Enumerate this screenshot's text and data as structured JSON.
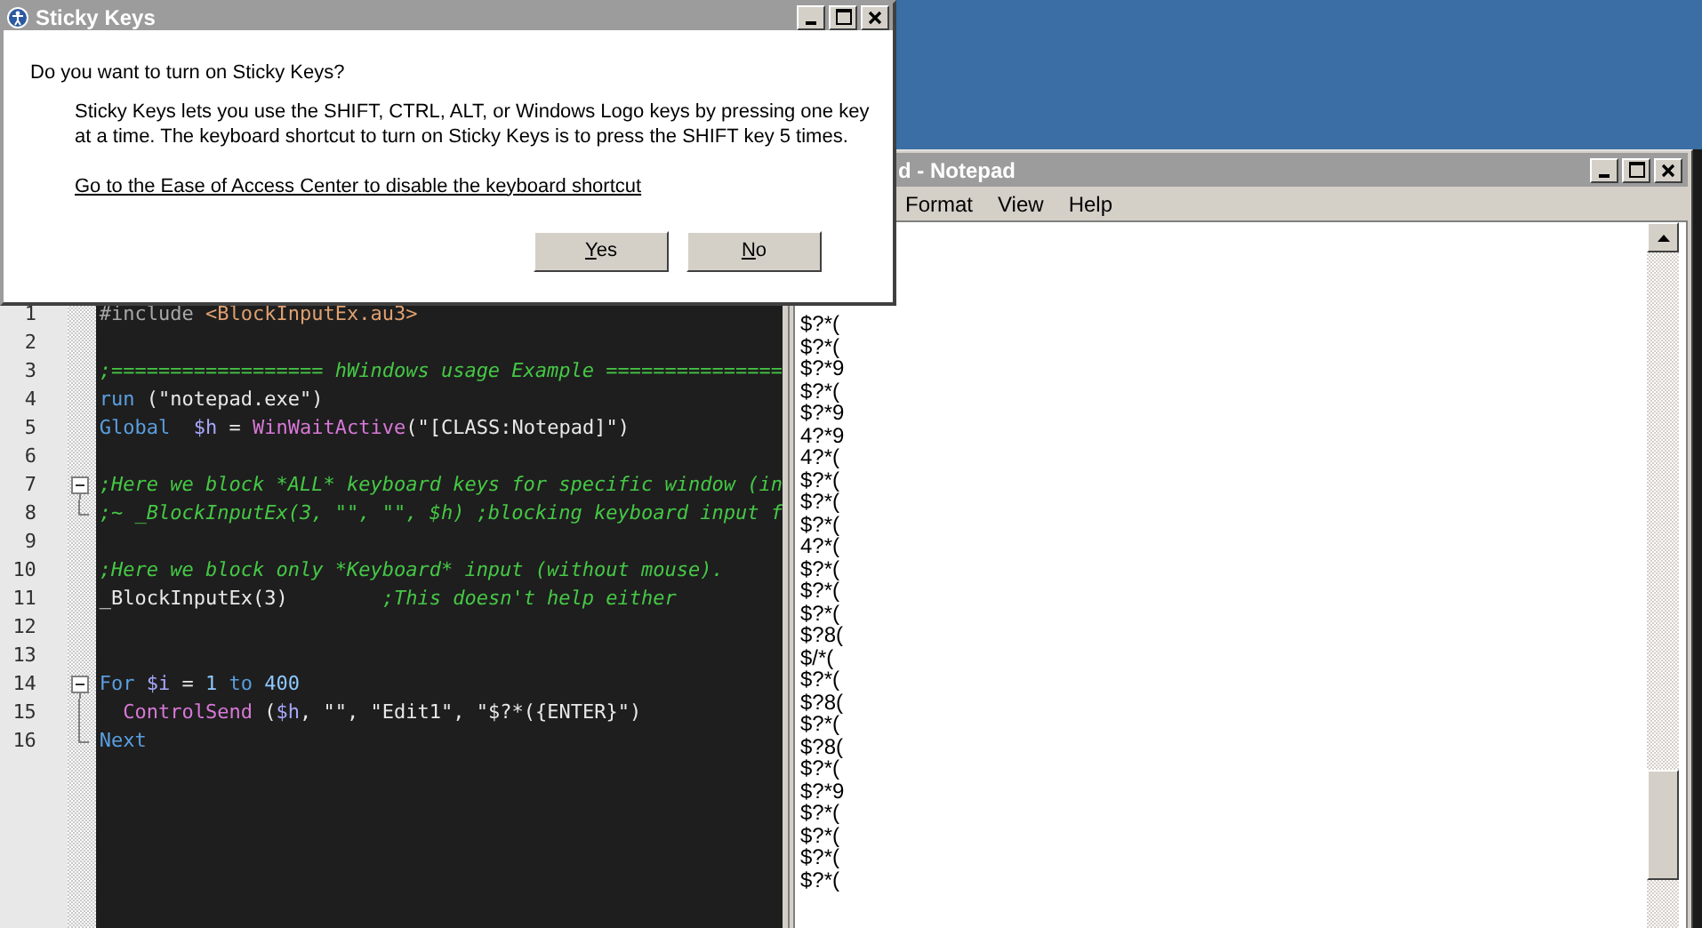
{
  "dialog": {
    "title": "Sticky Keys",
    "question": "Do you want to turn on Sticky Keys?",
    "description": "Sticky Keys lets you use the SHIFT, CTRL, ALT, or Windows Logo keys by pressing one key at a time. The keyboard shortcut to turn on Sticky Keys is to press the SHIFT key 5 times.",
    "link": "Go to the Ease of Access Center to disable the keyboard shortcut",
    "buttons": [
      {
        "label": "Yes",
        "underline_first": true
      },
      {
        "label": "No",
        "underline_first": true
      }
    ]
  },
  "editor": {
    "lines": [
      {
        "number": "1",
        "collapsible": false,
        "in_fold": false,
        "tokens": [
          {
            "kind": "directive",
            "text": "#include "
          },
          {
            "kind": "include",
            "text": "<BlockInputEx.au3>"
          }
        ]
      },
      {
        "number": "2",
        "collapsible": false,
        "in_fold": false
      },
      {
        "number": "3",
        "collapsible": false,
        "in_fold": false,
        "tokens": [
          {
            "kind": "comment",
            "text": ";================== hWindows usage Example ==============="
          }
        ]
      },
      {
        "number": "4",
        "collapsible": false,
        "in_fold": false,
        "tokens": [
          {
            "kind": "keyword",
            "text": "run"
          },
          {
            "kind": "plain",
            "text": " ("
          },
          {
            "kind": "string",
            "text": "\"notepad.exe\""
          },
          {
            "kind": "plain",
            "text": ")"
          }
        ]
      },
      {
        "number": "5",
        "collapsible": false,
        "in_fold": false,
        "tokens": [
          {
            "kind": "keyword",
            "text": "Global"
          },
          {
            "kind": "variable",
            "text": "  $h"
          },
          {
            "kind": "plain",
            "text": " = "
          },
          {
            "kind": "function",
            "text": "WinWaitActive"
          },
          {
            "kind": "plain",
            "text": "("
          },
          {
            "kind": "string",
            "text": "\"[CLASS:Notepad]\""
          },
          {
            "kind": "plain",
            "text": ")"
          }
        ]
      },
      {
        "number": "6",
        "collapsible": false,
        "in_fold": false
      },
      {
        "number": "7",
        "collapsible": true,
        "in_fold": false,
        "tokens": [
          {
            "kind": "comment",
            "text": ";Here we block *ALL* keyboard keys for specific window (in"
          }
        ]
      },
      {
        "number": "8",
        "collapsible": false,
        "in_fold": true,
        "tokens": [
          {
            "kind": "comment",
            "text": ";~ _BlockInputEx(3, \"\", \"\", $h) ;blocking keyboard input f"
          }
        ]
      },
      {
        "number": "9",
        "collapsible": false,
        "in_fold": false
      },
      {
        "number": "10",
        "collapsible": false,
        "in_fold": false,
        "tokens": [
          {
            "kind": "comment",
            "text": ";Here we block only *Keyboard* input (without mouse)."
          }
        ]
      },
      {
        "number": "11",
        "collapsible": false,
        "in_fold": false,
        "tokens": [
          {
            "kind": "plain",
            "text": "_BlockInputEx(3)        "
          },
          {
            "kind": "comment",
            "text": ";This doesn't help either"
          }
        ]
      },
      {
        "number": "12",
        "collapsible": false,
        "in_fold": false
      },
      {
        "number": "13",
        "collapsible": false,
        "in_fold": false
      },
      {
        "number": "14",
        "collapsible": true,
        "in_fold": false,
        "tokens": [
          {
            "kind": "keyword",
            "text": "For"
          },
          {
            "kind": "variable",
            "text": " $i"
          },
          {
            "kind": "plain",
            "text": " = "
          },
          {
            "kind": "number",
            "text": "1"
          },
          {
            "kind": "keyword",
            "text": " to"
          },
          {
            "kind": "number",
            "text": " 400"
          }
        ]
      },
      {
        "number": "15",
        "collapsible": false,
        "in_fold": true,
        "tokens": [
          {
            "kind": "function",
            "text": "  ControlSend"
          },
          {
            "kind": "plain",
            "text": " ("
          },
          {
            "kind": "variable",
            "text": "$h"
          },
          {
            "kind": "plain",
            "text": ", "
          },
          {
            "kind": "string",
            "text": "\"\""
          },
          {
            "kind": "plain",
            "text": ", "
          },
          {
            "kind": "string",
            "text": "\"Edit1\""
          },
          {
            "kind": "plain",
            "text": ", "
          },
          {
            "kind": "string",
            "text": "\"$?*({ENTER}\""
          },
          {
            "kind": "plain",
            "text": ")"
          }
        ]
      },
      {
        "number": "16",
        "collapsible": false,
        "in_fold": true,
        "tokens": [
          {
            "kind": "keyword",
            "text": "Next"
          }
        ]
      }
    ]
  },
  "notepad": {
    "title": "d - Notepad",
    "menu": [
      "Format",
      "View",
      "Help"
    ],
    "lines": [
      "$?*(",
      "$?*(",
      "$?*9",
      "$?*(",
      "$?*9",
      "4?*9",
      "4?*(",
      "$?*(",
      "$?*(",
      "$?*(",
      "4?*(",
      "$?*(",
      "$?*(",
      "$?*(",
      "$?8(",
      "$/*(",
      "$?*(",
      "$?8(",
      "$?*(",
      "$?8(",
      "$?*(",
      "$?*9",
      "$?*(",
      "$?*(",
      "$?*(",
      "$?*("
    ]
  }
}
